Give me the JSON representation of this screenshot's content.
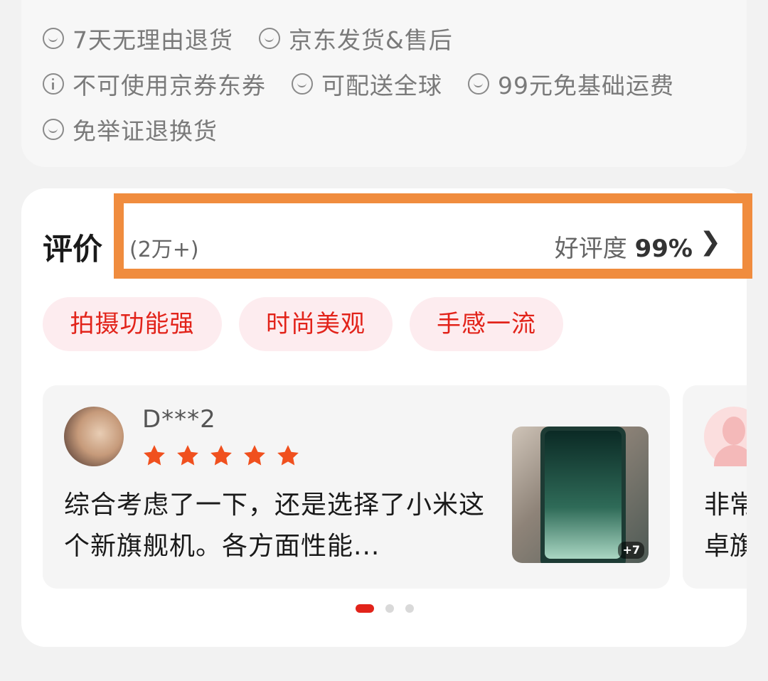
{
  "services": {
    "row1": [
      {
        "icon": "smile-icon",
        "text": "7天无理由退货"
      },
      {
        "icon": "smile-icon",
        "text": "京东发货&售后"
      }
    ],
    "row2": [
      {
        "icon": "info-icon",
        "text": "不可使用京券东券"
      },
      {
        "icon": "smile-icon",
        "text": "可配送全球"
      },
      {
        "icon": "smile-icon",
        "text": "99元免基础运费"
      }
    ],
    "row3": [
      {
        "icon": "smile-icon",
        "text": "免举证退换货"
      }
    ]
  },
  "reviews": {
    "title": "评价",
    "count": "(2万+)",
    "rate_label": "好评度",
    "rate_value": "99%",
    "chevron": "❯",
    "tags": [
      "拍摄功能强",
      "时尚美观",
      "手感一流"
    ],
    "items": [
      {
        "user": "D***2",
        "stars": 5,
        "text": "综合考虑了一下，还是选择了小米这个新旗舰机。各方面性能...",
        "image_count": "+7"
      },
      {
        "text": "非常\n卓旗"
      }
    ],
    "pagination": {
      "total": 3,
      "active": 0
    }
  },
  "colors": {
    "accent": "#e2231a",
    "highlight": "#f08c3e",
    "tag_bg": "#fdecef"
  }
}
